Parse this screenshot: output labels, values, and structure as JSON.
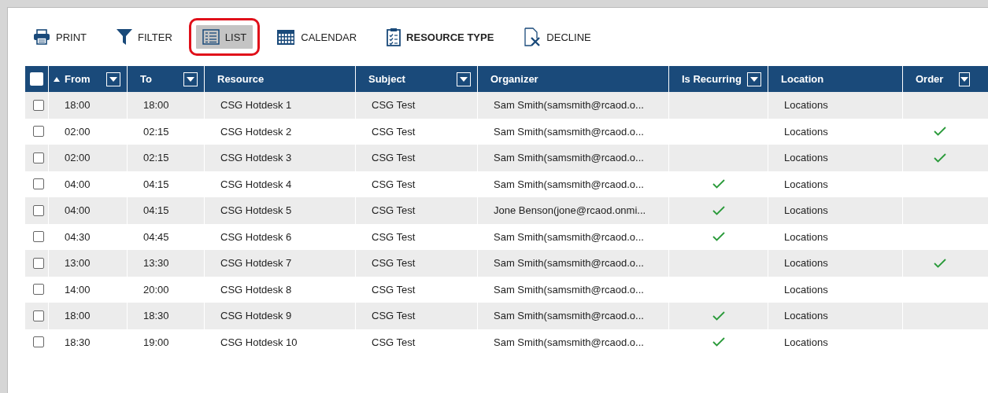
{
  "toolbar": [
    {
      "kind": "print",
      "label": "PRINT",
      "selected": false,
      "emphasized": false
    },
    {
      "kind": "filter",
      "label": "FILTER",
      "selected": false,
      "emphasized": false
    },
    {
      "kind": "list",
      "label": "LIST",
      "selected": true,
      "emphasized": false
    },
    {
      "kind": "calendar",
      "label": "CALENDAR",
      "selected": false,
      "emphasized": false
    },
    {
      "kind": "resource",
      "label": "RESOURCE TYPE",
      "selected": false,
      "emphasized": true
    },
    {
      "kind": "decline",
      "label": "DECLINE",
      "selected": false,
      "emphasized": false
    }
  ],
  "table": {
    "select_all": {
      "checked": false
    },
    "columns": [
      {
        "label": "From",
        "sorted": true,
        "filter": true
      },
      {
        "label": "To",
        "sorted": false,
        "filter": true
      },
      {
        "label": "Resource",
        "sorted": false,
        "filter": false
      },
      {
        "label": "Subject",
        "sorted": false,
        "filter": true
      },
      {
        "label": "Organizer",
        "sorted": false,
        "filter": false
      },
      {
        "label": "Is Recurring",
        "sorted": false,
        "filter": true
      },
      {
        "label": "Location",
        "sorted": false,
        "filter": false
      },
      {
        "label": "Order",
        "sorted": false,
        "filter": true
      }
    ],
    "rows": [
      {
        "checked": false,
        "from": "18:00",
        "to": "18:00",
        "resource": "CSG Hotdesk 1",
        "subject": "CSG Test",
        "organizer": "Sam Smith(samsmith@rcaod.o...",
        "is_recurring": false,
        "location": "Locations",
        "order": false
      },
      {
        "checked": false,
        "from": "02:00",
        "to": "02:15",
        "resource": "CSG Hotdesk 2",
        "subject": "CSG Test",
        "organizer": "Sam Smith(samsmith@rcaod.o...",
        "is_recurring": false,
        "location": "Locations",
        "order": true
      },
      {
        "checked": false,
        "from": "02:00",
        "to": "02:15",
        "resource": "CSG Hotdesk 3",
        "subject": "CSG Test",
        "organizer": "Sam Smith(samsmith@rcaod.o...",
        "is_recurring": false,
        "location": "Locations",
        "order": true
      },
      {
        "checked": false,
        "from": "04:00",
        "to": "04:15",
        "resource": "CSG Hotdesk 4",
        "subject": "CSG Test",
        "organizer": "Sam Smith(samsmith@rcaod.o...",
        "is_recurring": true,
        "location": "Locations",
        "order": false
      },
      {
        "checked": false,
        "from": "04:00",
        "to": "04:15",
        "resource": "CSG Hotdesk 5",
        "subject": "CSG Test",
        "organizer": "Jone Benson(jone@rcaod.onmi...",
        "is_recurring": true,
        "location": "Locations",
        "order": false
      },
      {
        "checked": false,
        "from": "04:30",
        "to": "04:45",
        "resource": "CSG Hotdesk 6",
        "subject": "CSG Test",
        "organizer": "Sam Smith(samsmith@rcaod.o...",
        "is_recurring": true,
        "location": "Locations",
        "order": false
      },
      {
        "checked": false,
        "from": "13:00",
        "to": "13:30",
        "resource": "CSG Hotdesk 7",
        "subject": "CSG Test",
        "organizer": "Sam Smith(samsmith@rcaod.o...",
        "is_recurring": false,
        "location": "Locations",
        "order": true
      },
      {
        "checked": false,
        "from": "14:00",
        "to": "20:00",
        "resource": "CSG Hotdesk 8",
        "subject": "CSG Test",
        "organizer": "Sam Smith(samsmith@rcaod.o...",
        "is_recurring": false,
        "location": "Locations",
        "order": false
      },
      {
        "checked": false,
        "from": "18:00",
        "to": "18:30",
        "resource": "CSG Hotdesk 9",
        "subject": "CSG Test",
        "organizer": "Sam Smith(samsmith@rcaod.o...",
        "is_recurring": true,
        "location": "Locations",
        "order": false
      },
      {
        "checked": false,
        "from": "18:30",
        "to": "19:00",
        "resource": "CSG Hotdesk 10",
        "subject": "CSG Test",
        "organizer": "Sam Smith(samsmith@rcaod.o...",
        "is_recurring": true,
        "location": "Locations",
        "order": false
      }
    ]
  }
}
